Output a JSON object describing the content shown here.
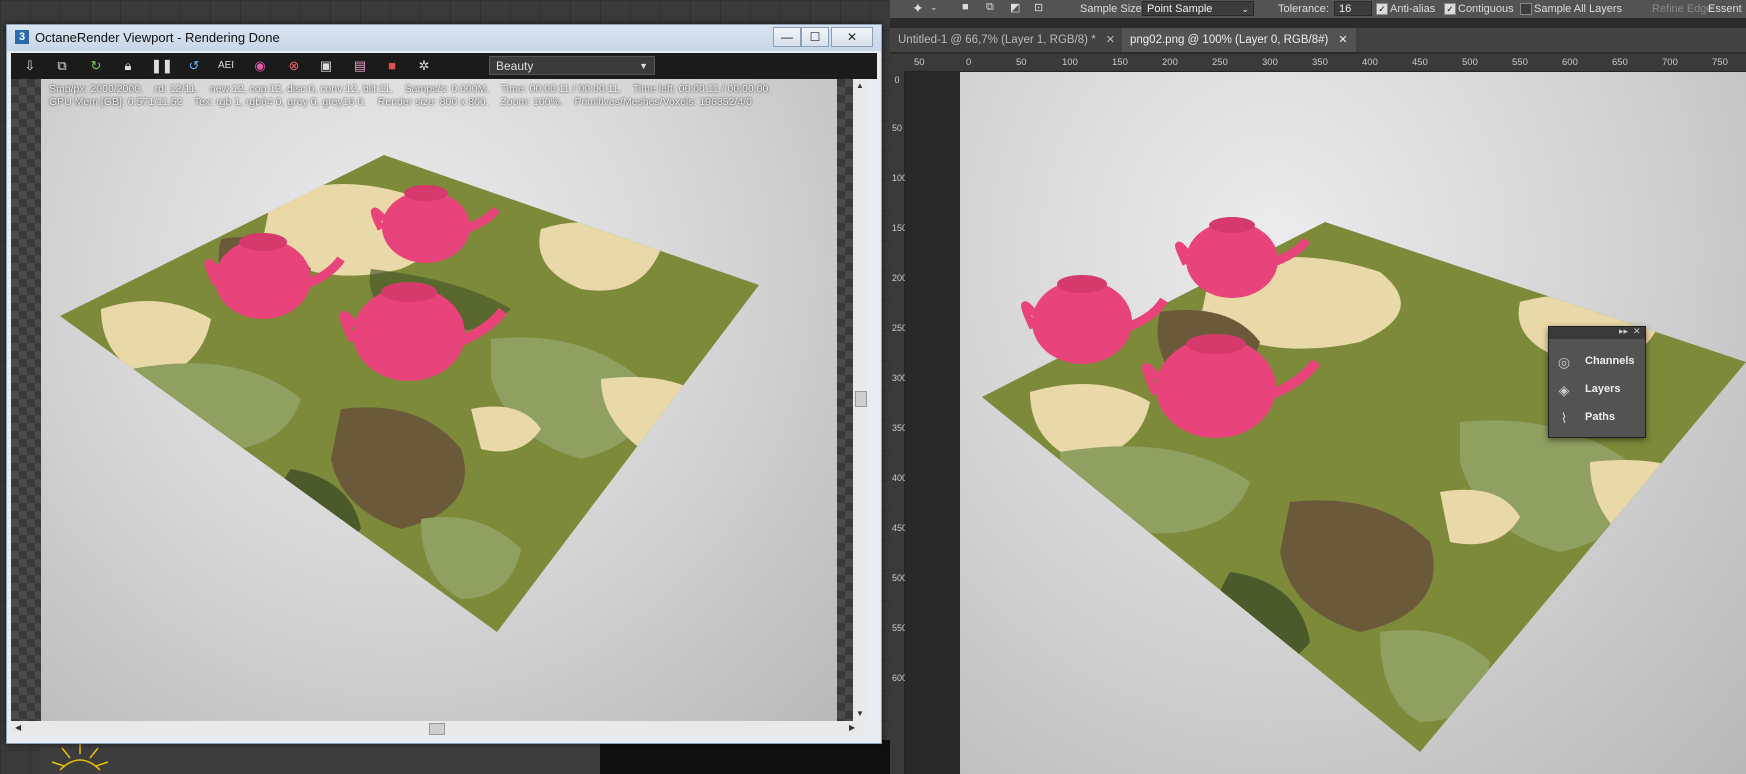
{
  "octane": {
    "title": "OctaneRender Viewport - Rendering Done",
    "app_icon": "3",
    "controls": {
      "minimize": "—",
      "maximize": "☐",
      "close": "✕"
    },
    "toolbar_icons": [
      "export-icon",
      "copy-icon",
      "refresh-icon",
      "lock-icon",
      "pause-icon",
      "restart-icon",
      "aei-icon",
      "color-icon",
      "region-icon",
      "display-icon",
      "film-icon",
      "camera-icon",
      "settings-icon"
    ],
    "render_pass": "Beauty",
    "stats_line1": "Smp/px: 2000/2000.    rd: 12/11.    new:12, cop:12, disc:0, conv:12, blit:11.    Samps/s: 0.000M.    Time: 00:00:11 / 00:00:11.    Time left: 00:00:11 / 00:00:00.",
    "stats_line2": "GPU Mem [GB]: 0.571/11.52    Tex: rgb 1, rgb64 0, grey 0, grey16 0.    Render size: 800 x 800.    Zoom: 100%.    Primitives/Meshes/Voxels: 196352/4/0"
  },
  "photoshop": {
    "options": {
      "sample_size_label": "Sample Size:",
      "sample_size_value": "Point Sample",
      "tolerance_label": "Tolerance:",
      "tolerance_value": "16",
      "anti_alias": "Anti-alias",
      "contiguous": "Contiguous",
      "sample_all_layers": "Sample All Layers",
      "refine_edge": "Refine Edge",
      "workspace": "Essent"
    },
    "tabs": [
      {
        "label": "Untitled-1 @ 66,7% (Layer 1, RGB/8) *",
        "close": "✕"
      },
      {
        "label": "png02.png @ 100% (Layer 0, RGB/8#)",
        "close": "✕"
      }
    ],
    "ruler_top": [
      "50",
      "0",
      "50",
      "100",
      "150",
      "200",
      "250",
      "300",
      "350",
      "400",
      "450",
      "500",
      "550",
      "600",
      "650",
      "700",
      "750"
    ],
    "ruler_left": [
      "0",
      "50",
      "100",
      "150",
      "200",
      "250",
      "300",
      "350",
      "400",
      "450",
      "500",
      "550",
      "600"
    ],
    "panel": {
      "items": [
        {
          "label": "Channels",
          "icon": "channels-icon"
        },
        {
          "label": "Layers",
          "icon": "layers-icon"
        },
        {
          "label": "Paths",
          "icon": "paths-icon"
        }
      ],
      "expand": "▸▸",
      "close": "✕"
    }
  },
  "colors": {
    "teapot": "#e8437a",
    "camo_light": "#ead9a8",
    "camo_olive": "#7c8a3a",
    "camo_green": "#8fa060",
    "camo_brown": "#6b5a3a",
    "camo_dark": "#4a5a2a"
  }
}
